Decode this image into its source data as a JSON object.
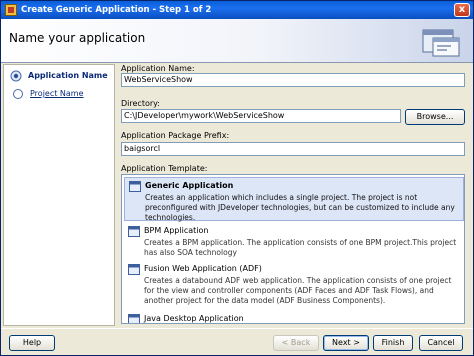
{
  "window": {
    "title": "Create Generic Application - Step 1 of 2",
    "close_label": "x"
  },
  "header": {
    "heading": "Name your application"
  },
  "sidebar": {
    "items": [
      {
        "label": "Application Name",
        "active": true
      },
      {
        "label": "Project Name",
        "active": false
      }
    ]
  },
  "form": {
    "app_name": {
      "label": "Application Name:",
      "value": "WebServiceShow"
    },
    "directory": {
      "label": "Directory:",
      "value": "C:\\JDeveloper\\mywork\\WebServiceShow",
      "browse_label": "Browse..."
    },
    "package_prefix": {
      "label": "Application Package Prefix:",
      "value": "baigsorcl"
    },
    "template": {
      "label": "Application Template:",
      "items": [
        {
          "name": "Generic Application",
          "selected": true,
          "description": "Creates an application which includes a single project. The project is not preconfigured with JDeveloper technologies, but can be customized to include any technologies."
        },
        {
          "name": "BPM Application",
          "selected": false,
          "description": "Creates a BPM application. The application consists of one BPM project.This project has also SOA technology"
        },
        {
          "name": "Fusion Web Application (ADF)",
          "selected": false,
          "description": "Creates a databound ADF web application. The application consists of one project for the view and controller components (ADF Faces and ADF Task Flows), and another project for the data model (ADF Business Components)."
        },
        {
          "name": "Java Desktop Application",
          "selected": false,
          "description": ""
        }
      ]
    }
  },
  "footer": {
    "help": "Help",
    "back": "< Back",
    "next": "Next >",
    "finish": "Finish",
    "cancel": "Cancel"
  }
}
